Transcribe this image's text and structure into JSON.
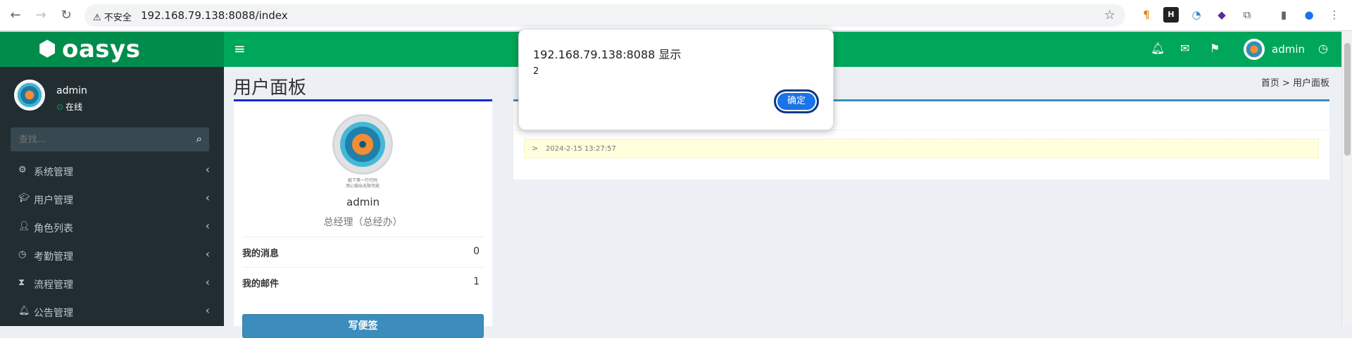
{
  "browser": {
    "insecure_label": "⚠ 不安全",
    "url": "192.168.79.138:8088/index"
  },
  "app": {
    "logo": "oasys",
    "header_user": "admin"
  },
  "sidebar": {
    "user_name": "admin",
    "status": "在线",
    "search_placeholder": "查找...",
    "items": [
      {
        "label": "系统管理",
        "icon": "gear-icon"
      },
      {
        "label": "用户管理",
        "icon": "graduation-cap-icon"
      },
      {
        "label": "角色列表",
        "icon": "user-icon"
      },
      {
        "label": "考勤管理",
        "icon": "clock-icon"
      },
      {
        "label": "流程管理",
        "icon": "hourglass-icon"
      },
      {
        "label": "公告管理",
        "icon": "bell-icon"
      }
    ]
  },
  "content": {
    "page_title": "用户面板",
    "breadcrumb": "首页 > 用户面板",
    "profile": {
      "avatar_caption": "敲下第一行代码\n用心做出无限可能",
      "name": "admin",
      "role": "总经理（总经办）",
      "messages_label": "我的消息",
      "messages_count": "0",
      "mail_label": "我的邮件",
      "mail_count": "1",
      "write_button": "写便签"
    },
    "notice": {
      "arrow": ">",
      "time": "2024-2-15 13:27:57"
    }
  },
  "dialog": {
    "title": "192.168.79.138:8088 显示",
    "message": "2",
    "ok_label": "确定"
  },
  "colors": {
    "header_green": "#00a65a",
    "logo_green": "#008d4c",
    "sidebar_dark": "#222d32",
    "profile_border": "#1428d4",
    "button_blue": "#3c8dbc"
  }
}
